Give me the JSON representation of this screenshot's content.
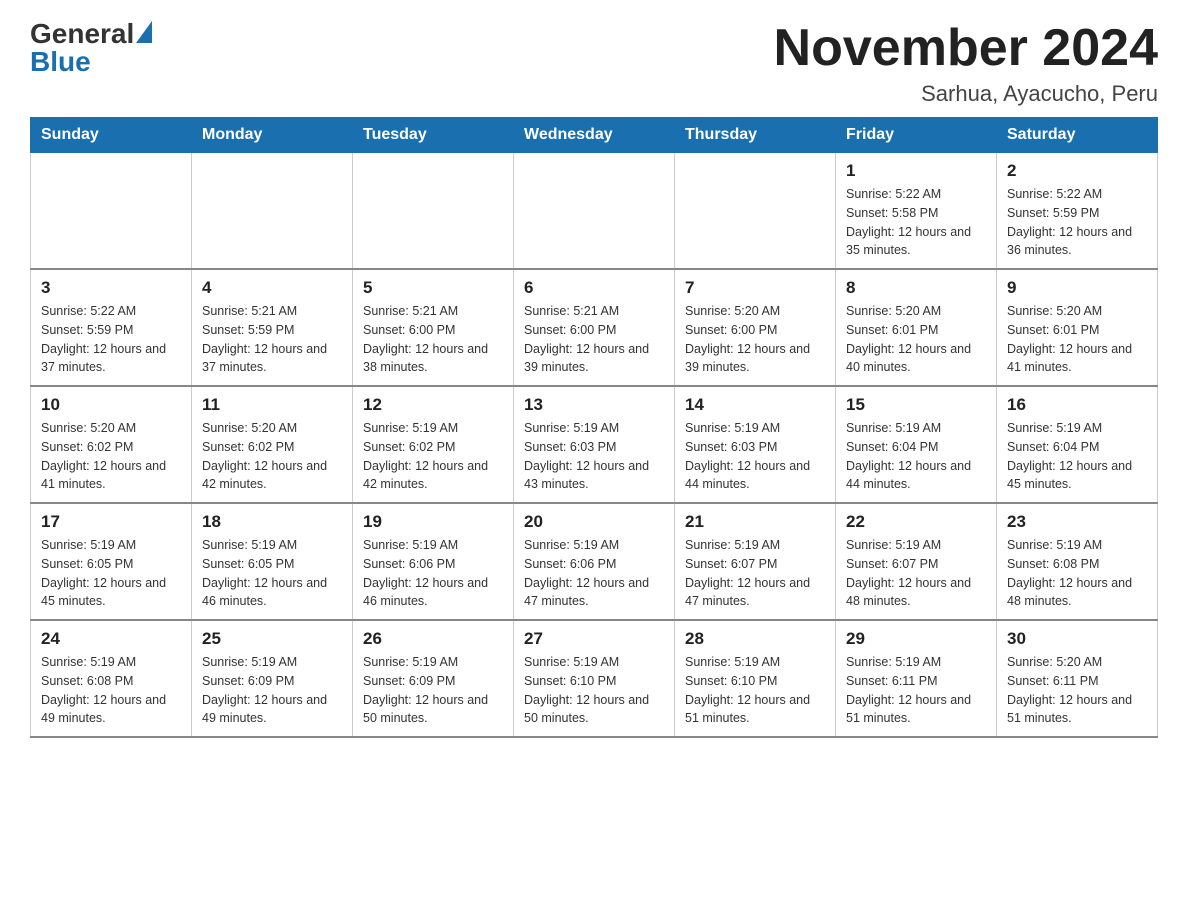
{
  "header": {
    "logo_general": "General",
    "logo_blue": "Blue",
    "month_title": "November 2024",
    "location": "Sarhua, Ayacucho, Peru"
  },
  "weekdays": [
    "Sunday",
    "Monday",
    "Tuesday",
    "Wednesday",
    "Thursday",
    "Friday",
    "Saturday"
  ],
  "weeks": [
    [
      {
        "day": "",
        "sunrise": "",
        "sunset": "",
        "daylight": ""
      },
      {
        "day": "",
        "sunrise": "",
        "sunset": "",
        "daylight": ""
      },
      {
        "day": "",
        "sunrise": "",
        "sunset": "",
        "daylight": ""
      },
      {
        "day": "",
        "sunrise": "",
        "sunset": "",
        "daylight": ""
      },
      {
        "day": "",
        "sunrise": "",
        "sunset": "",
        "daylight": ""
      },
      {
        "day": "1",
        "sunrise": "Sunrise: 5:22 AM",
        "sunset": "Sunset: 5:58 PM",
        "daylight": "Daylight: 12 hours and 35 minutes."
      },
      {
        "day": "2",
        "sunrise": "Sunrise: 5:22 AM",
        "sunset": "Sunset: 5:59 PM",
        "daylight": "Daylight: 12 hours and 36 minutes."
      }
    ],
    [
      {
        "day": "3",
        "sunrise": "Sunrise: 5:22 AM",
        "sunset": "Sunset: 5:59 PM",
        "daylight": "Daylight: 12 hours and 37 minutes."
      },
      {
        "day": "4",
        "sunrise": "Sunrise: 5:21 AM",
        "sunset": "Sunset: 5:59 PM",
        "daylight": "Daylight: 12 hours and 37 minutes."
      },
      {
        "day": "5",
        "sunrise": "Sunrise: 5:21 AM",
        "sunset": "Sunset: 6:00 PM",
        "daylight": "Daylight: 12 hours and 38 minutes."
      },
      {
        "day": "6",
        "sunrise": "Sunrise: 5:21 AM",
        "sunset": "Sunset: 6:00 PM",
        "daylight": "Daylight: 12 hours and 39 minutes."
      },
      {
        "day": "7",
        "sunrise": "Sunrise: 5:20 AM",
        "sunset": "Sunset: 6:00 PM",
        "daylight": "Daylight: 12 hours and 39 minutes."
      },
      {
        "day": "8",
        "sunrise": "Sunrise: 5:20 AM",
        "sunset": "Sunset: 6:01 PM",
        "daylight": "Daylight: 12 hours and 40 minutes."
      },
      {
        "day": "9",
        "sunrise": "Sunrise: 5:20 AM",
        "sunset": "Sunset: 6:01 PM",
        "daylight": "Daylight: 12 hours and 41 minutes."
      }
    ],
    [
      {
        "day": "10",
        "sunrise": "Sunrise: 5:20 AM",
        "sunset": "Sunset: 6:02 PM",
        "daylight": "Daylight: 12 hours and 41 minutes."
      },
      {
        "day": "11",
        "sunrise": "Sunrise: 5:20 AM",
        "sunset": "Sunset: 6:02 PM",
        "daylight": "Daylight: 12 hours and 42 minutes."
      },
      {
        "day": "12",
        "sunrise": "Sunrise: 5:19 AM",
        "sunset": "Sunset: 6:02 PM",
        "daylight": "Daylight: 12 hours and 42 minutes."
      },
      {
        "day": "13",
        "sunrise": "Sunrise: 5:19 AM",
        "sunset": "Sunset: 6:03 PM",
        "daylight": "Daylight: 12 hours and 43 minutes."
      },
      {
        "day": "14",
        "sunrise": "Sunrise: 5:19 AM",
        "sunset": "Sunset: 6:03 PM",
        "daylight": "Daylight: 12 hours and 44 minutes."
      },
      {
        "day": "15",
        "sunrise": "Sunrise: 5:19 AM",
        "sunset": "Sunset: 6:04 PM",
        "daylight": "Daylight: 12 hours and 44 minutes."
      },
      {
        "day": "16",
        "sunrise": "Sunrise: 5:19 AM",
        "sunset": "Sunset: 6:04 PM",
        "daylight": "Daylight: 12 hours and 45 minutes."
      }
    ],
    [
      {
        "day": "17",
        "sunrise": "Sunrise: 5:19 AM",
        "sunset": "Sunset: 6:05 PM",
        "daylight": "Daylight: 12 hours and 45 minutes."
      },
      {
        "day": "18",
        "sunrise": "Sunrise: 5:19 AM",
        "sunset": "Sunset: 6:05 PM",
        "daylight": "Daylight: 12 hours and 46 minutes."
      },
      {
        "day": "19",
        "sunrise": "Sunrise: 5:19 AM",
        "sunset": "Sunset: 6:06 PM",
        "daylight": "Daylight: 12 hours and 46 minutes."
      },
      {
        "day": "20",
        "sunrise": "Sunrise: 5:19 AM",
        "sunset": "Sunset: 6:06 PM",
        "daylight": "Daylight: 12 hours and 47 minutes."
      },
      {
        "day": "21",
        "sunrise": "Sunrise: 5:19 AM",
        "sunset": "Sunset: 6:07 PM",
        "daylight": "Daylight: 12 hours and 47 minutes."
      },
      {
        "day": "22",
        "sunrise": "Sunrise: 5:19 AM",
        "sunset": "Sunset: 6:07 PM",
        "daylight": "Daylight: 12 hours and 48 minutes."
      },
      {
        "day": "23",
        "sunrise": "Sunrise: 5:19 AM",
        "sunset": "Sunset: 6:08 PM",
        "daylight": "Daylight: 12 hours and 48 minutes."
      }
    ],
    [
      {
        "day": "24",
        "sunrise": "Sunrise: 5:19 AM",
        "sunset": "Sunset: 6:08 PM",
        "daylight": "Daylight: 12 hours and 49 minutes."
      },
      {
        "day": "25",
        "sunrise": "Sunrise: 5:19 AM",
        "sunset": "Sunset: 6:09 PM",
        "daylight": "Daylight: 12 hours and 49 minutes."
      },
      {
        "day": "26",
        "sunrise": "Sunrise: 5:19 AM",
        "sunset": "Sunset: 6:09 PM",
        "daylight": "Daylight: 12 hours and 50 minutes."
      },
      {
        "day": "27",
        "sunrise": "Sunrise: 5:19 AM",
        "sunset": "Sunset: 6:10 PM",
        "daylight": "Daylight: 12 hours and 50 minutes."
      },
      {
        "day": "28",
        "sunrise": "Sunrise: 5:19 AM",
        "sunset": "Sunset: 6:10 PM",
        "daylight": "Daylight: 12 hours and 51 minutes."
      },
      {
        "day": "29",
        "sunrise": "Sunrise: 5:19 AM",
        "sunset": "Sunset: 6:11 PM",
        "daylight": "Daylight: 12 hours and 51 minutes."
      },
      {
        "day": "30",
        "sunrise": "Sunrise: 5:20 AM",
        "sunset": "Sunset: 6:11 PM",
        "daylight": "Daylight: 12 hours and 51 minutes."
      }
    ]
  ]
}
